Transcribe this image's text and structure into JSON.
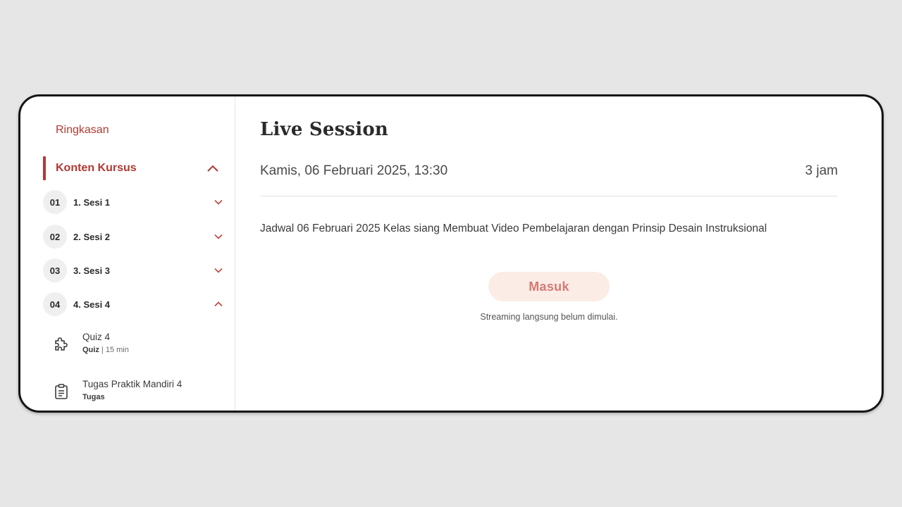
{
  "sidebar": {
    "summary_label": "Ringkasan",
    "section_label": "Konten Kursus",
    "sessions": [
      {
        "num": "01",
        "title": "1. Sesi 1",
        "expanded": false
      },
      {
        "num": "02",
        "title": "2. Sesi 2",
        "expanded": false
      },
      {
        "num": "03",
        "title": "3. Sesi 3",
        "expanded": false
      },
      {
        "num": "04",
        "title": "4. Sesi 4",
        "expanded": true
      }
    ],
    "activities": [
      {
        "name": "Quiz 4",
        "type": "Quiz",
        "duration": "| 15 min",
        "icon": "puzzle-icon"
      },
      {
        "name": "Tugas Praktik Mandiri 4",
        "type": "Tugas",
        "duration": "",
        "icon": "clipboard-icon"
      }
    ]
  },
  "main": {
    "title": "Live Session",
    "datetime": "Kamis, 06 Februari 2025, 13:30",
    "duration": "3 jam",
    "description": "Jadwal 06 Februari 2025 Kelas siang Membuat Video Pembelajaran dengan Prinsip Desain Instruksional",
    "enter_label": "Masuk",
    "status_note": "Streaming langsung belum dimulai."
  },
  "colors": {
    "accent": "#b03a33",
    "button_bg": "#fbece6",
    "button_text": "#d47a74",
    "page_bg": "#e6e6e6"
  }
}
